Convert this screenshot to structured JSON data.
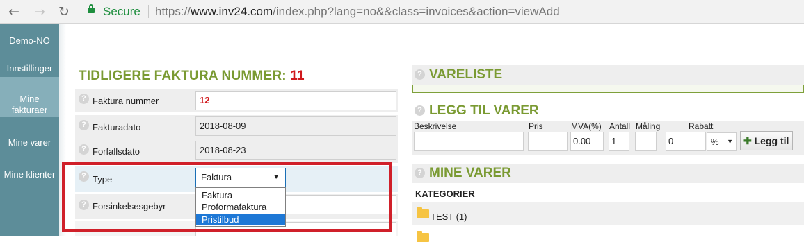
{
  "browser": {
    "back_icon": "arrow-left-icon",
    "forward_icon": "arrow-right-icon",
    "reload_icon": "reload-icon",
    "security_label": "Secure",
    "url_scheme": "https://",
    "url_host": "www.inv24.com",
    "url_path": "/index.php?lang=no&&class=invoices&action=viewAdd"
  },
  "sidebar": {
    "items": [
      {
        "label": "Demo-NO"
      },
      {
        "label": "Innstillinger"
      },
      {
        "label": "Mine fakturaer",
        "line1": "Mine",
        "line2": "fakturaer",
        "active": true
      },
      {
        "label": "Mine varer"
      },
      {
        "label": "Mine klienter"
      }
    ]
  },
  "form": {
    "previous_title": "TIDLIGERE FAKTURA NUMMER:",
    "previous_number": "11",
    "fields": {
      "invoice_number": {
        "label": "Faktura nummer",
        "value": "12"
      },
      "invoice_date": {
        "label": "Fakturadato",
        "value": "2018-08-09"
      },
      "due_date": {
        "label": "Forfallsdato",
        "value": "2018-08-23"
      },
      "type": {
        "label": "Type",
        "value": "Faktura"
      },
      "late_fee": {
        "label": "Forsinkelsesgebyr"
      }
    },
    "type_options": [
      "Faktura",
      "Proformafaktura",
      "Pristilbud"
    ],
    "highlighted_option": "Pristilbud"
  },
  "products": {
    "list_title": "VARELISTE",
    "add_title": "LEGG TIL VARER",
    "columns": {
      "description": "Beskrivelse",
      "price": "Pris",
      "vat": "MVA(%)",
      "quantity": "Antall",
      "unit": "Måling",
      "discount": "Rabatt"
    },
    "values": {
      "vat": "0.00",
      "quantity": "1",
      "discount": "0",
      "discount_unit": "%"
    },
    "add_button": "Legg til",
    "my_products_title": "MINE VARER",
    "categories_label": "KATEGORIER",
    "category_link": "TEST (1)"
  },
  "colors": {
    "sidebar": "#5d8d99",
    "sidebar_active": "#86afba",
    "heading_green": "#7a9a32",
    "accent_red": "#d0181c",
    "highlight_box": "#d0202a",
    "selected_option": "#1e78d6"
  }
}
